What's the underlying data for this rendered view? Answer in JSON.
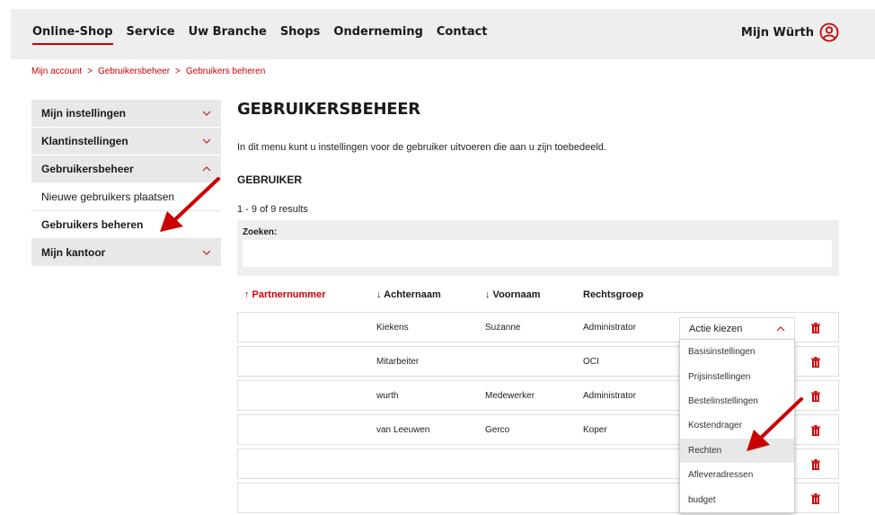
{
  "topnav": {
    "items": [
      "Online-Shop",
      "Service",
      "Uw Branche",
      "Shops",
      "Onderneming",
      "Contact"
    ],
    "account_label": "Mijn Würth"
  },
  "breadcrumb": [
    "Mijn account",
    "Gebruikersbeheer",
    "Gebruikers beheren"
  ],
  "breadcrumb_sep": ">",
  "sidebar": {
    "items": [
      {
        "label": "Mijn instellingen"
      },
      {
        "label": "Klantinstellingen"
      },
      {
        "label": "Gebruikersbeheer"
      },
      {
        "label": "Nieuwe gebruikers plaatsen"
      },
      {
        "label": "Gebruikers beheren"
      },
      {
        "label": "Mijn kantoor"
      }
    ]
  },
  "main": {
    "title": "GEBRUIKERSBEHEER",
    "intro": "In dit menu kunt u instellingen voor de gebruiker uitvoeren die aan u zijn toebedeeld.",
    "section_title": "GEBRUIKER",
    "results": "1 - 9 of 9 results",
    "search_label": "Zoeken:",
    "search_value": ""
  },
  "table": {
    "headers": [
      "↑ Partnernummer",
      "↓ Achternaam",
      "↓ Voornaam",
      "Rechtsgroep"
    ],
    "rows": [
      {
        "partner": "",
        "lastname": "Kiekens",
        "firstname": "Suzanne",
        "group": "Administrator"
      },
      {
        "partner": "",
        "lastname": "Mitarbeiter",
        "firstname": "",
        "group": "OCI"
      },
      {
        "partner": "",
        "lastname": "wurth",
        "firstname": "Medewerker",
        "group": "Administrator"
      },
      {
        "partner": "",
        "lastname": "van Leeuwen",
        "firstname": "Gerco",
        "group": "Koper"
      },
      {
        "partner": "",
        "lastname": "",
        "firstname": "",
        "group": ""
      },
      {
        "partner": "",
        "lastname": "",
        "firstname": "",
        "group": ""
      }
    ]
  },
  "dropdown": {
    "label": "Actie kiezen",
    "options": [
      "Basisinstellingen",
      "Prijsinstellingen",
      "Bestelinstellingen",
      "Kostendrager",
      "Rechten",
      "Afleveradressen",
      "budget"
    ],
    "highlighted": "Rechten"
  },
  "colors": {
    "brand_red": "#cc0000",
    "topbar_bg": "#eeeeee",
    "sidebar_bg": "#e8e8e8"
  }
}
